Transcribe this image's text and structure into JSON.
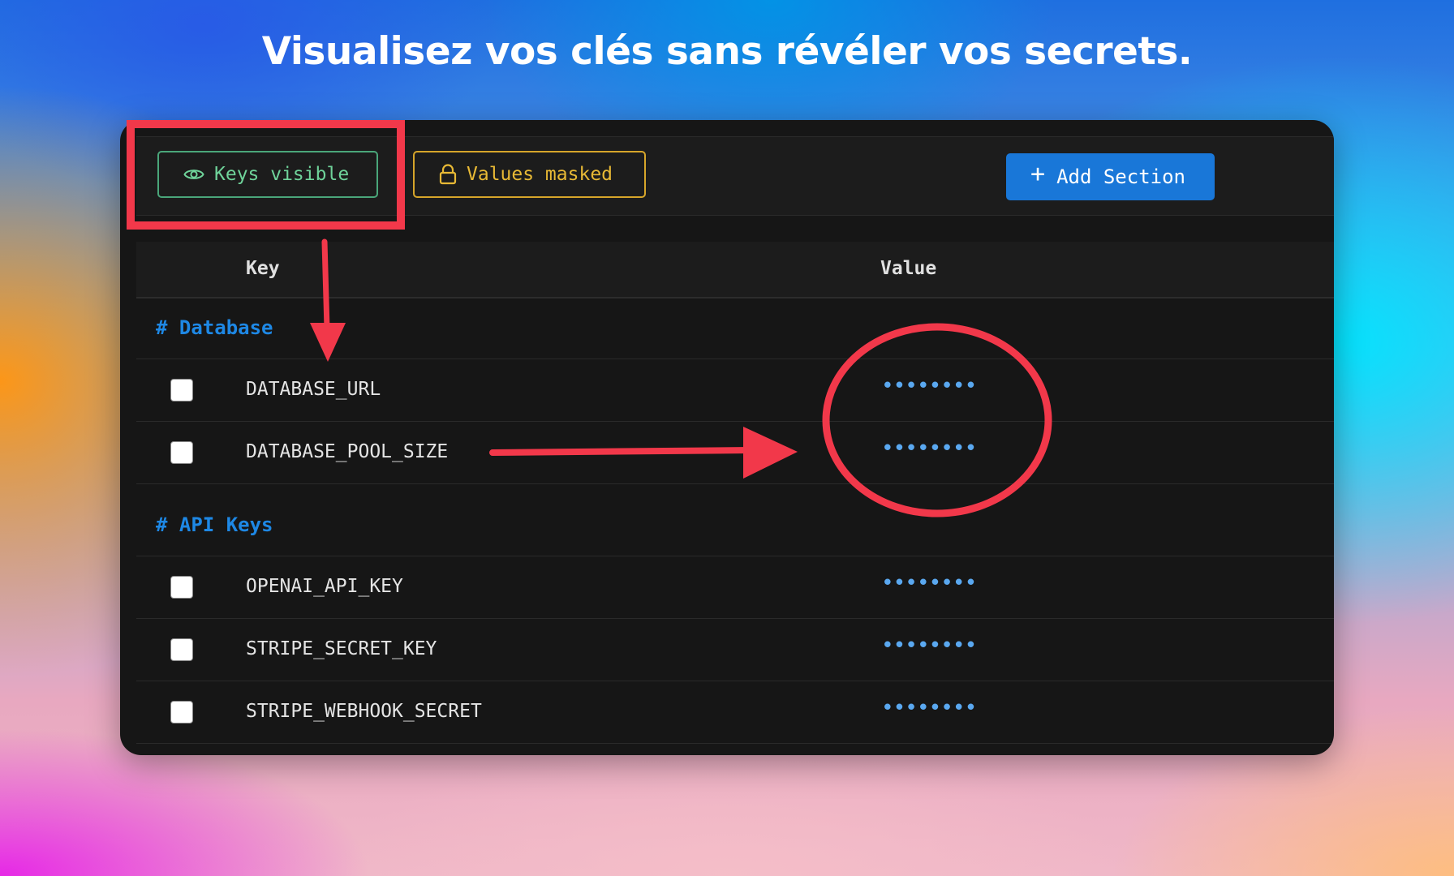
{
  "headline": "Visualisez vos clés sans révéler vos secrets.",
  "toolbar": {
    "keys_visible_label": "Keys visible",
    "values_masked_label": "Values masked",
    "add_section_label": "Add Section",
    "add_icon": "+"
  },
  "table": {
    "columns": [
      "Key",
      "Value"
    ]
  },
  "sections": [
    {
      "label": "# Database",
      "rows": [
        {
          "key": "DATABASE_URL",
          "value": "••••••••"
        },
        {
          "key": "DATABASE_POOL_SIZE",
          "value": "••••••••"
        }
      ]
    },
    {
      "label": "# API Keys",
      "rows": [
        {
          "key": "OPENAI_API_KEY",
          "value": "••••••••"
        },
        {
          "key": "STRIPE_SECRET_KEY",
          "value": "••••••••"
        },
        {
          "key": "STRIPE_WEBHOOK_SECRET",
          "value": "••••••••"
        }
      ]
    }
  ],
  "icons": {
    "keys_visible": "eye-icon",
    "values_masked": "lock-icon",
    "add_section": "plus-icon"
  },
  "colors": {
    "keys_visible": "#6fd39a",
    "values_masked": "#e8b935",
    "accent_blue": "#1977d8",
    "section_label": "#1e88e5",
    "masked_value": "#5aa8f0",
    "annotation_red": "#f2384a"
  }
}
